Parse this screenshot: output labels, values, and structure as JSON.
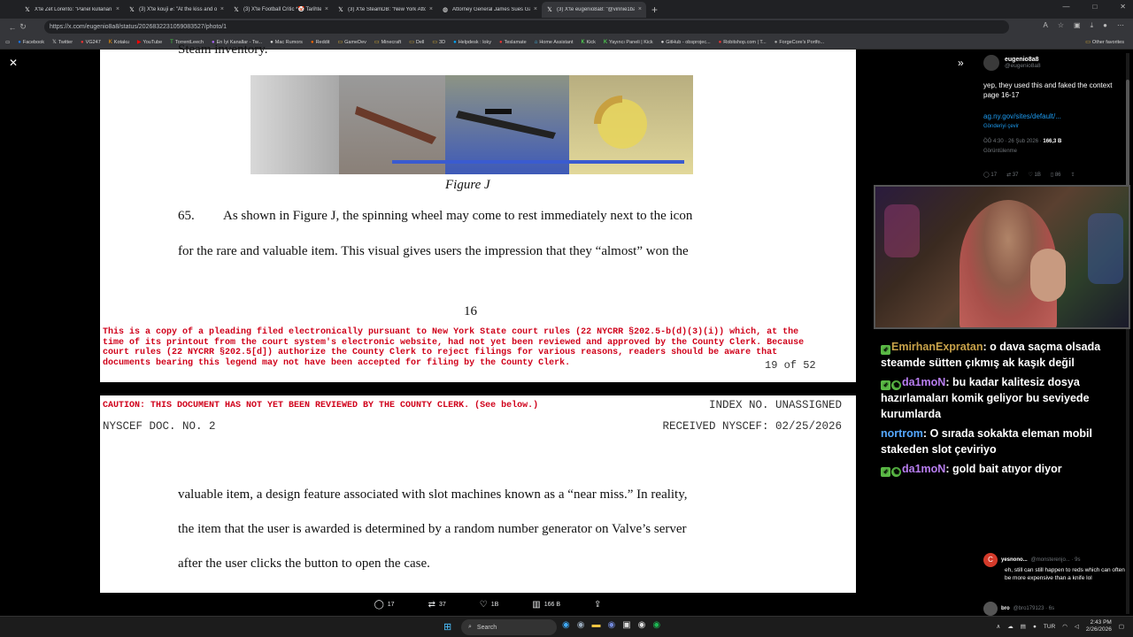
{
  "browser": {
    "tabs": [
      {
        "label": "X'te Zet Lorento: \"Panel kullanan u",
        "icon": "x-icon",
        "active": false
      },
      {
        "label": "(3) X'te kouji ⌀: \"At the kiss and o",
        "icon": "x-icon",
        "active": false
      },
      {
        "label": "(3) X'te Football Critic *🤡 Tarihte",
        "icon": "x-icon",
        "active": false
      },
      {
        "label": "(3) X'te SteamDB: \"New York Attor",
        "icon": "x-icon",
        "active": false
      },
      {
        "label": "Attorney General James Sues Gam",
        "icon": "globe-icon",
        "active": false
      },
      {
        "label": "(3) X'te eugenio8a8: \"@vinnie1ba",
        "icon": "x-icon",
        "active": true
      }
    ],
    "url": "https://x.com/eugenio8a8/status/2026832231059083527/photo/1",
    "bookmarks": [
      "Facebook",
      "Twitter",
      "VG247",
      "Kotaku",
      "YouTube",
      "TorrentLeech",
      "En İyi Kanallar - Tw...",
      "Mac Rumors",
      "Reddit",
      "GameDev",
      "Minecraft",
      "Dell",
      "3D",
      "Helpdesk : loky",
      "Teslamate",
      "Home Assistant",
      "Kick",
      "Yayıncı Paneli | Kick",
      "GitHub - obsprojec...",
      "Robitshop.com | T...",
      "ForgeCore's Portfo..."
    ],
    "other_favorites": "Other favorites"
  },
  "document": {
    "top_cut_text": "Steam inventory.",
    "figure_caption": "Figure J",
    "para_65_num": "65.",
    "para_65_line1": "As shown in Figure J, the spinning wheel may come to rest immediately next to the icon",
    "para_65_line2": "for the rare and valuable item.  This visual gives users the impression that they “almost” won the",
    "page_number": "16",
    "legend": "This is a copy of a pleading filed electronically pursuant to New York State court rules (22 NYCRR §202.5-b(d)(3)(i)) which, at the time of its printout from the court system's electronic website, had not yet been reviewed and approved by the County Clerk. Because court rules (22 NYCRR §202.5[d]) authorize the County Clerk to reject filings for various reasons, readers should be aware that documents bearing this legend may not have been accepted for filing by the County Clerk.",
    "page_count": "19 of 52",
    "caution": "CAUTION: THIS DOCUMENT HAS NOT YET BEEN REVIEWED BY THE COUNTY CLERK. (See below.)",
    "index_no": "INDEX NO. UNASSIGNED",
    "nyscef_doc": "NYSCEF DOC. NO. 2",
    "received": "RECEIVED NYSCEF: 02/25/2026",
    "cont_line1": "valuable item, a design feature associated with slot machines known as a “near miss.”  In reality,",
    "cont_line2": "the item that the user is awarded is determined by a random number generator on Valve’s server",
    "cont_line3": "after the user clicks the button to open the case."
  },
  "engagement": {
    "replies": "17",
    "reposts": "37",
    "likes": "1B",
    "views": "166 B"
  },
  "tweet": {
    "name": "eugenio8a8",
    "handle": "@eugenio8a8",
    "text": "yep, they used this and faked the context\npage 16-17",
    "link": "ag.ny.gov/sites/default/...",
    "translate": "Gönderiyi çevir",
    "time": "ÖÖ 4:30 · 26 Şub 2026 · ",
    "views_count": "166,3 B",
    "views_label": "Görüntülenme",
    "actions": {
      "replies": "17",
      "reposts": "37",
      "likes": "1B",
      "bookmarks": "86"
    }
  },
  "chat": [
    {
      "user": "EmirhanExpratan",
      "msg": "o dava saçma olsada steamde sütten çıkmış ak kaşık değil",
      "badges": [
        "vip"
      ],
      "color": "#c8a24a"
    },
    {
      "user": "da1moN",
      "msg": "bu kadar kalitesiz dosya hazırlamaları komik geliyor bu seviyede kurumlarda",
      "badges": [
        "vip",
        "star"
      ],
      "color": "#b87ef0"
    },
    {
      "user": "nortrom",
      "msg": "O sırada sokakta eleman mobil stakeden slot çeviriyo",
      "badges": [],
      "color": "#55a8ff"
    },
    {
      "user": "da1moN",
      "msg": "gold bait atıyor diyor",
      "badges": [
        "vip",
        "star"
      ],
      "color": "#b87ef0"
    }
  ],
  "replies": [
    {
      "name": "yesnono...",
      "handle": "@monsterenjo... · 9s",
      "text": "eh, still can still happen to reds which can often be more expensive than a knife lol",
      "initial": "C"
    },
    {
      "name": "bro",
      "handle": "@bro179123 · 6s"
    }
  ],
  "taskbar": {
    "search": "Search",
    "lang": "TUR",
    "time": "2:43 PM",
    "date": "2/26/2026"
  }
}
